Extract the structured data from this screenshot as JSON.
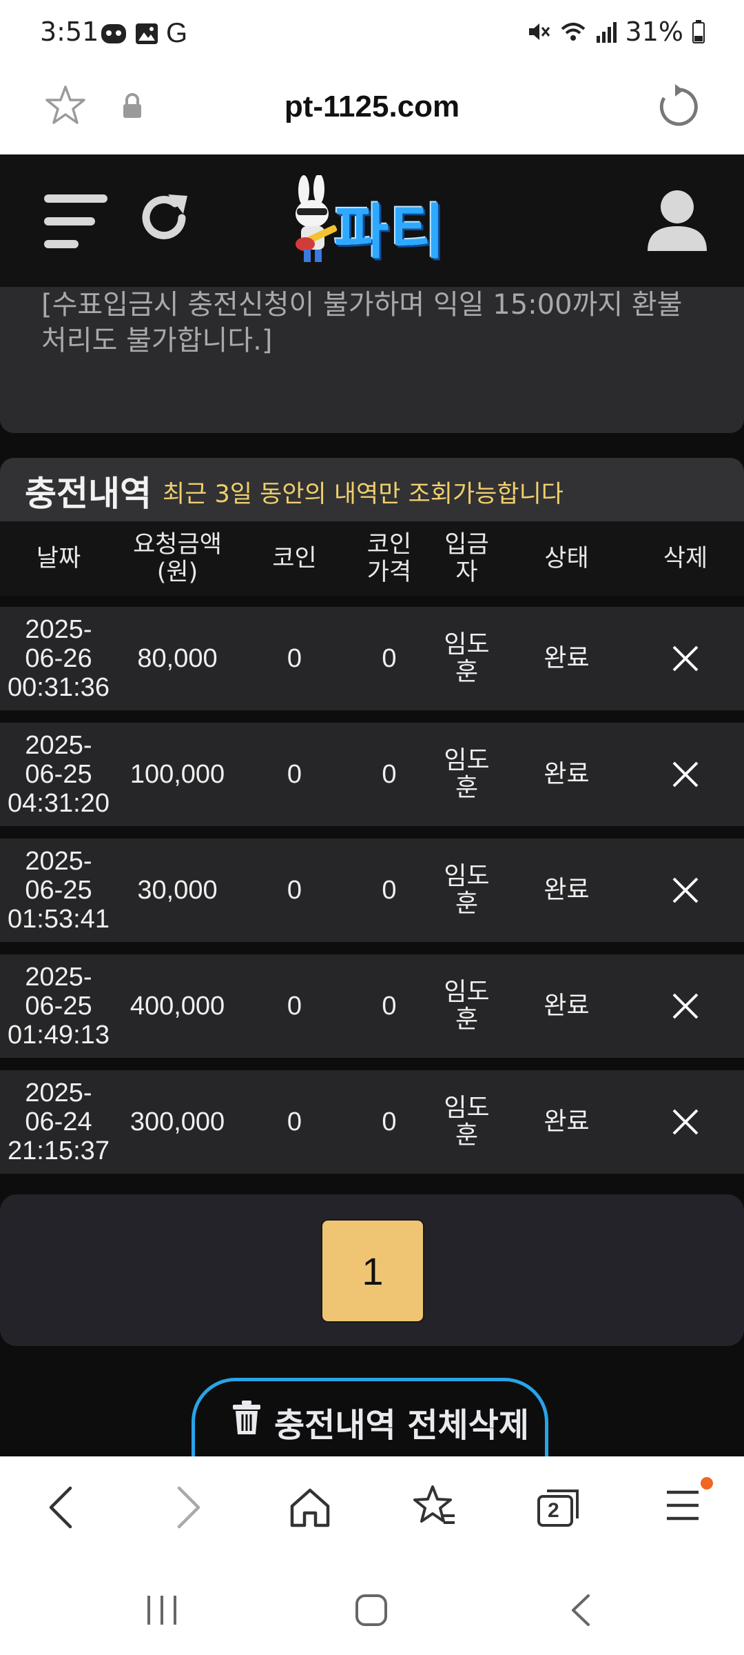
{
  "status_bar": {
    "time": "3:51",
    "carrier_g": "G",
    "battery": "31%"
  },
  "browser": {
    "url": "pt-1125.com",
    "tab_count": "2"
  },
  "site": {
    "logo_text": "파티"
  },
  "notice": {
    "text": "[수표입금시 충전신청이 불가하며 익일 15:00까지 환불 처리도 불가합니다.]"
  },
  "section": {
    "title": "충전내역",
    "subtitle": "최근 3일 동안의 내역만 조회가능합니다"
  },
  "table": {
    "headers": {
      "date": "날짜",
      "amount": "요청금액\n(원)",
      "coin": "코인",
      "coin_price": "코인\n가격",
      "depositor": "입금\n자",
      "status": "상태",
      "delete": "삭제"
    },
    "rows": [
      {
        "date": "2025-\n06-26\n00:31:36",
        "amount": "80,000",
        "coin": "0",
        "coin_price": "0",
        "depositor": "임도\n훈",
        "status": "완료"
      },
      {
        "date": "2025-\n06-25\n04:31:20",
        "amount": "100,000",
        "coin": "0",
        "coin_price": "0",
        "depositor": "임도\n훈",
        "status": "완료"
      },
      {
        "date": "2025-\n06-25\n01:53:41",
        "amount": "30,000",
        "coin": "0",
        "coin_price": "0",
        "depositor": "임도\n훈",
        "status": "완료"
      },
      {
        "date": "2025-\n06-25\n01:49:13",
        "amount": "400,000",
        "coin": "0",
        "coin_price": "0",
        "depositor": "임도\n훈",
        "status": "완료"
      },
      {
        "date": "2025-\n06-24\n21:15:37",
        "amount": "300,000",
        "coin": "0",
        "coin_price": "0",
        "depositor": "임도\n훈",
        "status": "완료"
      }
    ]
  },
  "pagination": {
    "current_page": "1"
  },
  "actions": {
    "delete_all": "충전내역 전체삭제"
  },
  "colors": {
    "accent_gold": "#efc574",
    "subtitle_yellow": "#f0cf6d",
    "button_border_blue": "#2aa3e8",
    "notification_dot": "#f26522"
  }
}
